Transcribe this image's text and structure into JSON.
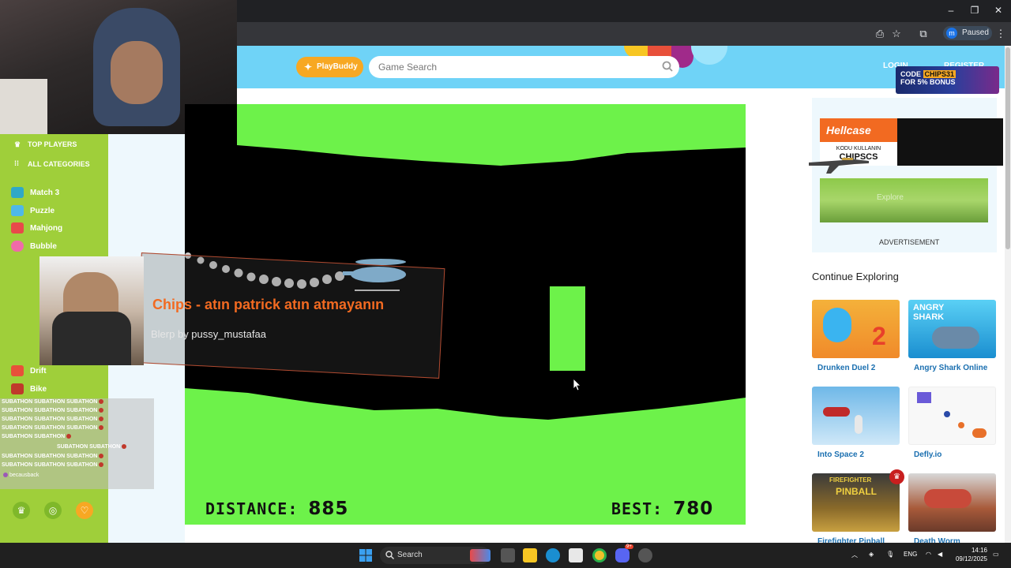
{
  "browser": {
    "profile_initial": "m",
    "profile_status": "Paused",
    "window_controls": {
      "minimize": "–",
      "restore": "❐",
      "close": "✕"
    }
  },
  "header": {
    "playbuddy_label": "PlayBuddy",
    "search_placeholder": "Game Search",
    "login_label": "LOGIN",
    "register_label": "REGISTER"
  },
  "sidebar": {
    "top_links": [
      "TOP PLAYERS",
      "ALL CATEGORIES"
    ],
    "categories": [
      {
        "label": "Match 3",
        "color": "#2fa8c8"
      },
      {
        "label": "Puzzle",
        "color": "#4fb8e8"
      },
      {
        "label": "Mahjong",
        "color": "#e84a4a"
      },
      {
        "label": "Bubble",
        "color": "#f06aa8"
      },
      {
        "label": "Drift",
        "color": "#e8503a"
      },
      {
        "label": "Bike",
        "color": "#c0392b"
      }
    ]
  },
  "game": {
    "distance_label": "DISTANCE:",
    "distance_value": "885",
    "best_label": "BEST:",
    "best_value": "780"
  },
  "alert": {
    "title": "Chips - atın patrick atın atmayanın",
    "subtitle": "Blerp by pussy_mustafaa"
  },
  "chat": {
    "lines": [
      "SUBATHON SUBATHON SUBATHON",
      "SUBATHON SUBATHON SUBATHON",
      "SUBATHON SUBATHON SUBATHON",
      "SUBATHON SUBATHON SUBATHON",
      "SUBATHON SUBATHON",
      "SUBATHON SUBATHON",
      "SUBATHON SUBATHON SUBATHON",
      "SUBATHON SUBATHON SUBATHON"
    ],
    "last_user": "becausback"
  },
  "ads": {
    "code_banner_line1": "CODE",
    "code_banner_code": "CHIPS31",
    "code_banner_line2": "FOR 5% BONUS",
    "hellcase_brand": "Hellcase",
    "hellcase_text": "KODU KULLANIN",
    "hellcase_code": "CHIPSCS",
    "landscape_text": "Explore",
    "advertisement_label": "ADVERTISEMENT"
  },
  "continue_exploring": {
    "title": "Continue Exploring",
    "games": [
      {
        "name": "Drunken Duel 2"
      },
      {
        "name": "Angry Shark Online"
      },
      {
        "name": "Into Space 2"
      },
      {
        "name": "Defly.io"
      },
      {
        "name": "Firefighter Pinball"
      },
      {
        "name": "Death Worm"
      }
    ]
  },
  "taskbar": {
    "search_label": "Search",
    "language": "ENG",
    "time": "14:16",
    "date": "09/12/2025",
    "discord_badge": "9+"
  }
}
